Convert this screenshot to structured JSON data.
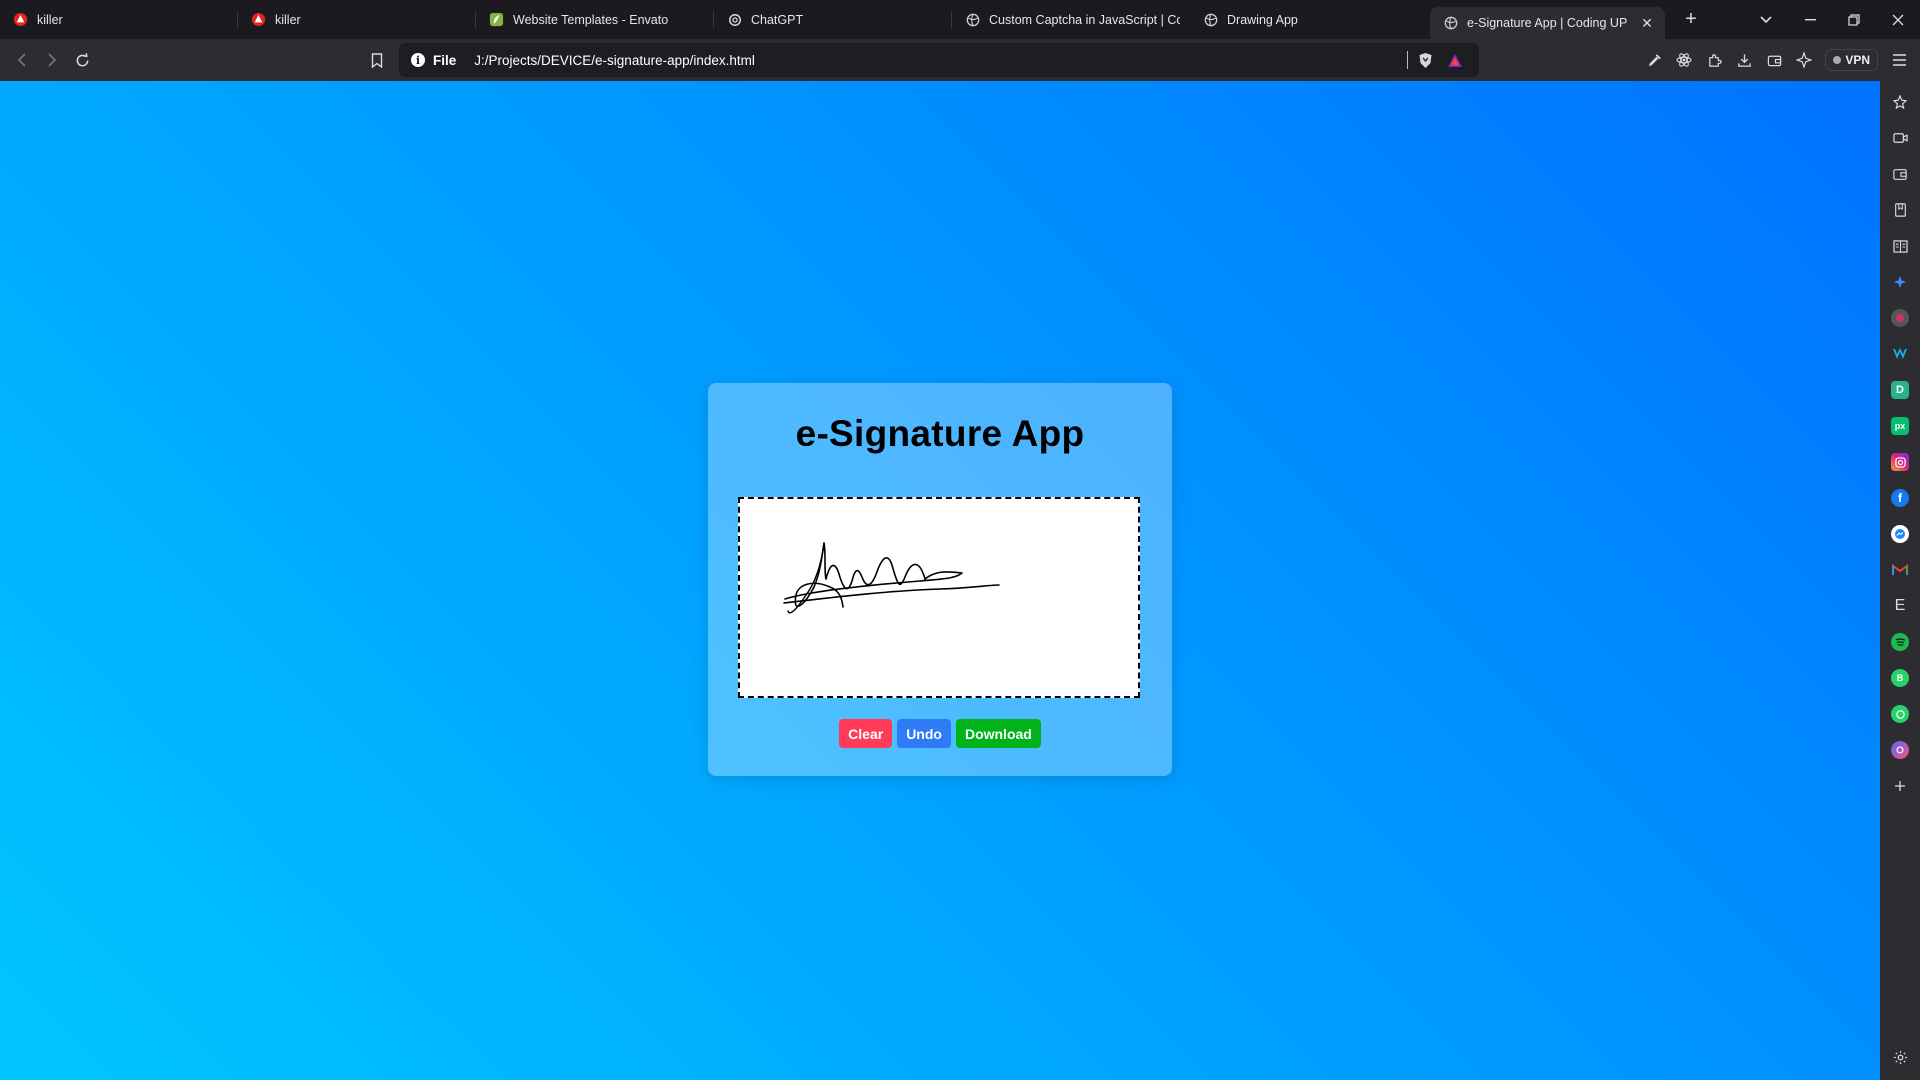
{
  "browser": {
    "tabs": [
      {
        "title": "killer",
        "icon": "brave-icon"
      },
      {
        "title": "killer",
        "icon": "brave-icon"
      },
      {
        "title": "Website Templates - Envato",
        "icon": "envato-icon"
      },
      {
        "title": "ChatGPT",
        "icon": "chatgpt-icon"
      },
      {
        "title": "Custom Captcha in JavaScript | Codi",
        "icon": "globe-icon"
      },
      {
        "title": "Drawing App",
        "icon": "globe-icon"
      },
      {
        "title": "e-Signature App | Coding UP",
        "icon": "globe-icon",
        "active": true
      }
    ],
    "address": {
      "scheme": "File",
      "url": "J:/Projects/DEVICE/e-signature-app/index.html"
    },
    "vpn_label": "VPN"
  },
  "app": {
    "title": "e-Signature App",
    "buttons": {
      "clear": "Clear",
      "undo": "Undo",
      "download": "Download"
    },
    "colors": {
      "clear": "#ff3b57",
      "undo": "#2f7bf5",
      "download": "#00b31b",
      "gradient_start": "#00c6ff",
      "gradient_end": "#0072ff"
    }
  },
  "side_panel_icons": [
    "bookmark-star-icon",
    "video-icon",
    "wallet-icon",
    "bookmarks-icon",
    "reading-list-icon",
    "leo-ai-icon",
    "brave-talk-icon",
    "malwarebytes-icon",
    "dictionary-icon",
    "pixabay-icon",
    "instagram-icon",
    "facebook-icon",
    "messenger-icon",
    "gmail-icon",
    "envato-icon",
    "spotify-icon",
    "whatsapp-business-icon",
    "whatsapp-icon",
    "chatgpt-app-icon",
    "add-panel-icon"
  ]
}
